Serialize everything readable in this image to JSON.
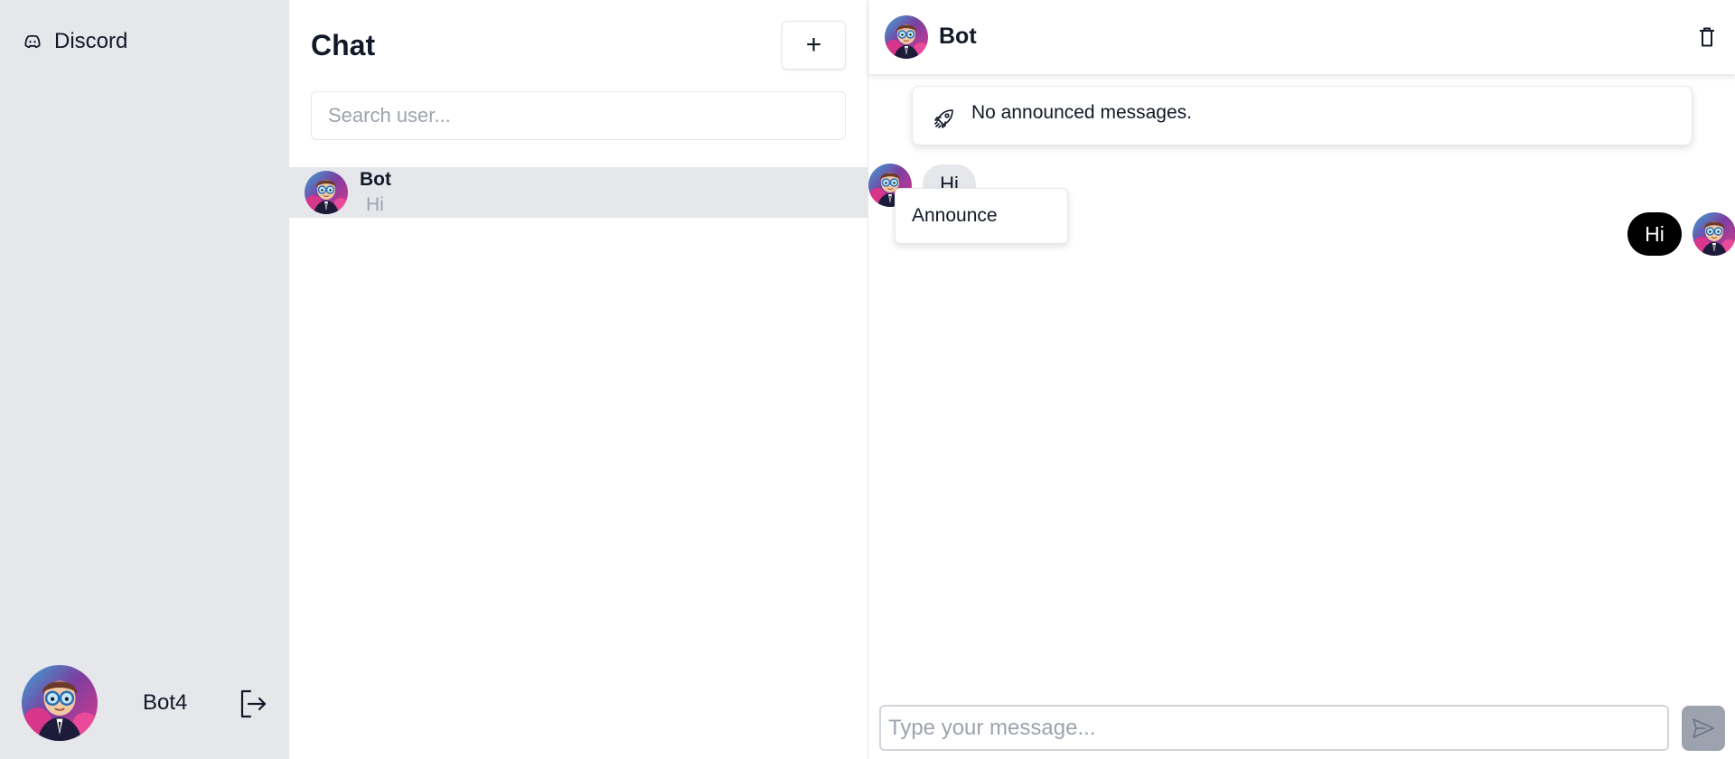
{
  "nav": {
    "brand_label": "Discord",
    "brand_icon": "discord-icon",
    "profile_name": "Bot4",
    "logout_icon": "logout-icon"
  },
  "chat_list": {
    "title": "Chat",
    "add_label": "+",
    "search_placeholder": "Search user...",
    "conversations": [
      {
        "name": "Bot",
        "last_message": "Hi"
      }
    ]
  },
  "conversation": {
    "contact_name": "Bot",
    "delete_icon": "trash-icon",
    "announcement": {
      "icon": "rocket-icon",
      "text": "No announced messages."
    },
    "messages": [
      {
        "direction": "incoming",
        "text": "Hi"
      },
      {
        "direction": "outgoing",
        "text": "Hi"
      }
    ],
    "context_menu": {
      "items": [
        "Announce"
      ]
    },
    "composer_placeholder": "Type your message...",
    "send_icon": "send-icon"
  },
  "colors": {
    "sidebar_bg": "#e5e7eb",
    "selected_row": "#e5e7eb",
    "incoming_bubble": "#e5e7eb",
    "outgoing_bubble": "#000000",
    "send_button": "#9ca3af",
    "placeholder": "#9ca3af"
  }
}
